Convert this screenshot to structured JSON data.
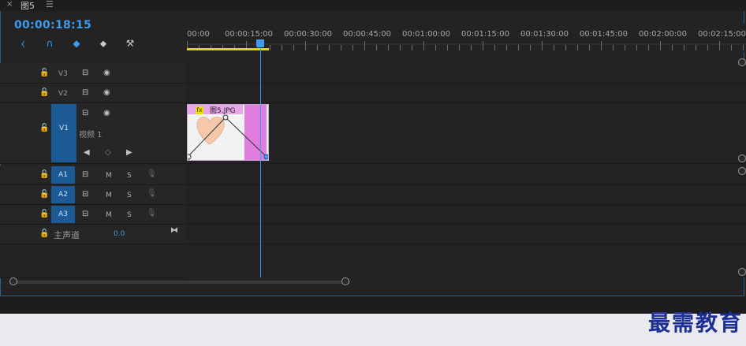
{
  "tab": {
    "close": "×",
    "title": "图5",
    "menu": "☰"
  },
  "timecode": "00:00:18:15",
  "toolbar": {
    "snap": "⧼",
    "magnet": "∩",
    "linked": "◆",
    "marker": "⬥",
    "wrench": "⚒"
  },
  "ruler": [
    "00:00",
    "00:00:15:00",
    "00:00:30:00",
    "00:00:45:00",
    "00:01:00:00",
    "00:01:15:00",
    "00:01:30:00",
    "00:01:45:00",
    "00:02:00:00",
    "00:02:15:00"
  ],
  "tracks": {
    "v3": "V3",
    "v2": "V2",
    "v1_box": "V1",
    "v1_name": "视频 1",
    "a1": "A1",
    "a2": "A2",
    "a3": "A3",
    "m": "M",
    "s": "S",
    "master_label": "主声道",
    "master_value": "0.0"
  },
  "clip": {
    "fx": "fx",
    "name": "图5.JPG"
  },
  "watermark": "最需教育"
}
